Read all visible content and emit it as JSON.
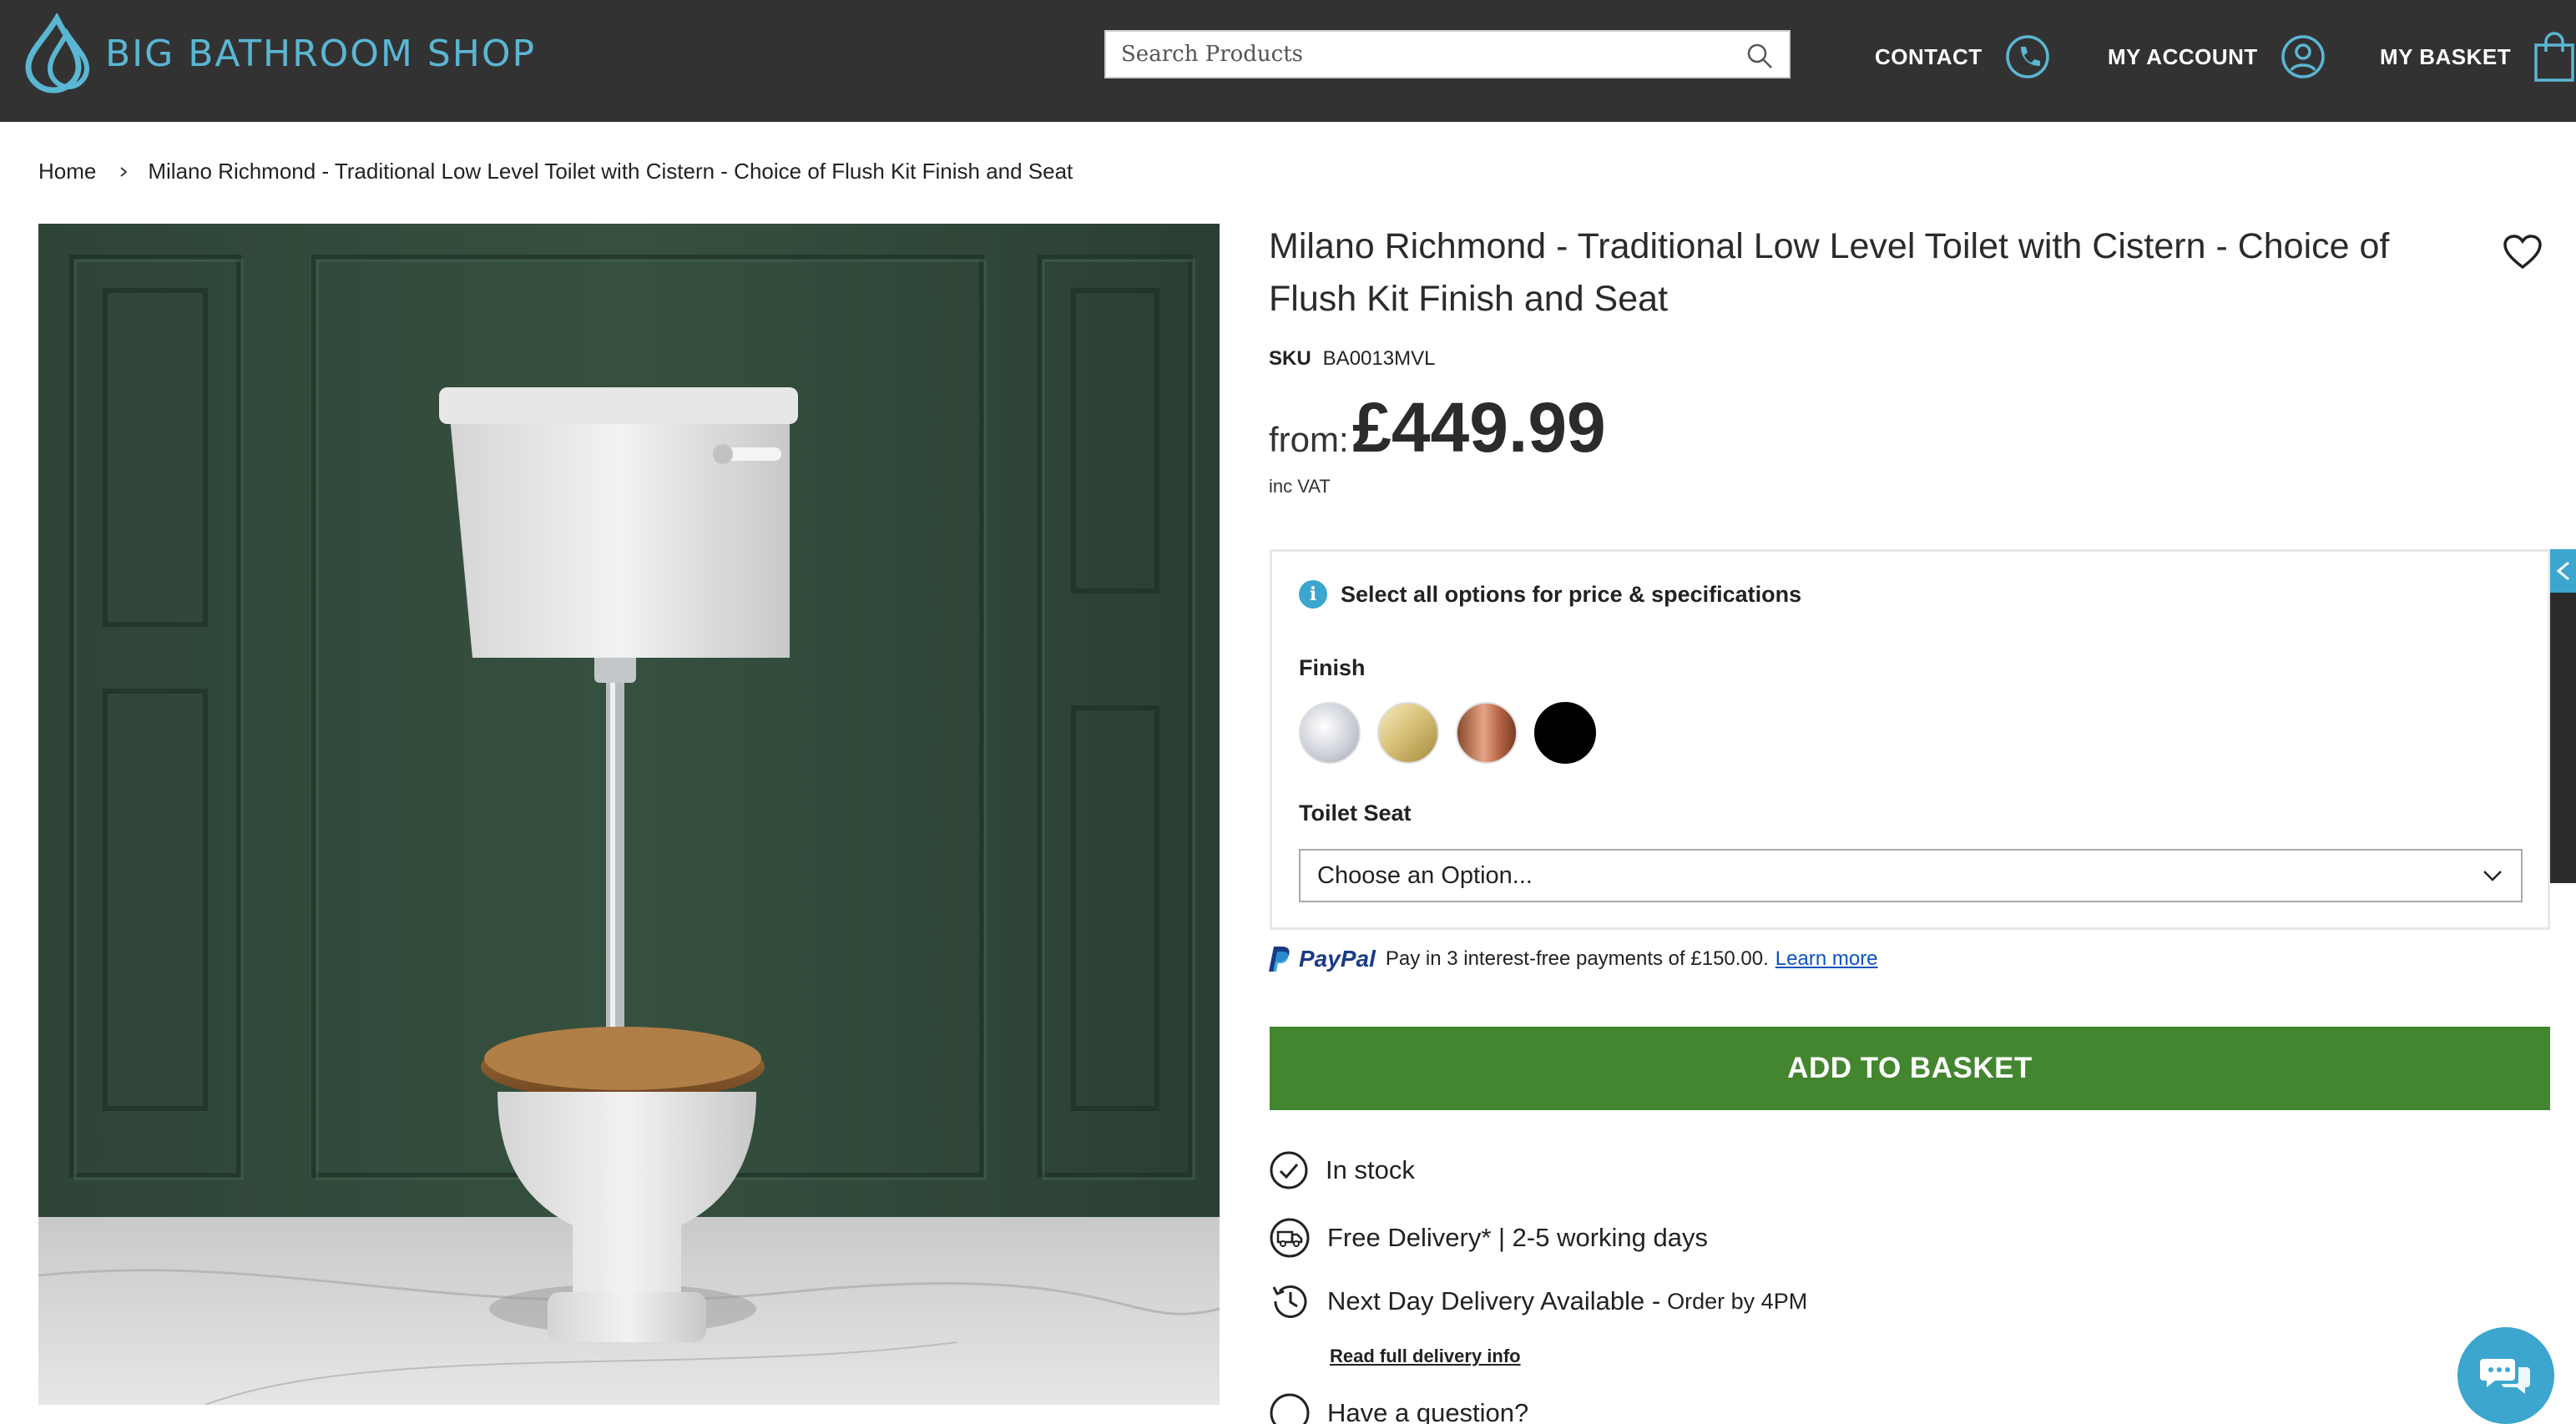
{
  "header": {
    "logo_text": "BIG BATHROOM SHOP",
    "search_placeholder": "Search Products",
    "contact_label": "CONTACT",
    "account_label": "MY ACCOUNT",
    "basket_label": "MY BASKET"
  },
  "breadcrumb": {
    "home": "Home",
    "current": "Milano Richmond - Traditional Low Level Toilet with Cistern - Choice of Flush Kit Finish and Seat"
  },
  "product": {
    "title": "Milano Richmond - Traditional Low Level Toilet with Cistern - Choice of Flush Kit Finish and Seat",
    "sku_label": "SKU",
    "sku": "BA0013MVL",
    "price_prefix": "from:",
    "price": "£449.99",
    "vat_note": "inc VAT"
  },
  "options": {
    "info_text": "Select all options for price & specifications",
    "finish_label": "Finish",
    "finish_swatches": [
      "chrome",
      "brushed-brass",
      "brushed-copper",
      "black"
    ],
    "seat_label": "Toilet Seat",
    "seat_selected": "Choose an Option..."
  },
  "paypal": {
    "brand": "PayPal",
    "text": "Pay in 3 interest-free payments of £150.00.",
    "link": "Learn more"
  },
  "actions": {
    "add_to_basket": "ADD TO BASKET"
  },
  "status": {
    "stock": "In stock",
    "free_delivery": "Free Delivery* | 2-5 working days",
    "next_day_main": "Next Day Delivery Available - ",
    "next_day_note": "Order by 4PM",
    "delivery_link": "Read full delivery info",
    "question": "Have a question?"
  },
  "colors": {
    "header_bg": "#333233",
    "brand_blue": "#5ab6d3",
    "accent_blue": "#3ca6cf",
    "basket_green": "#43862f"
  }
}
